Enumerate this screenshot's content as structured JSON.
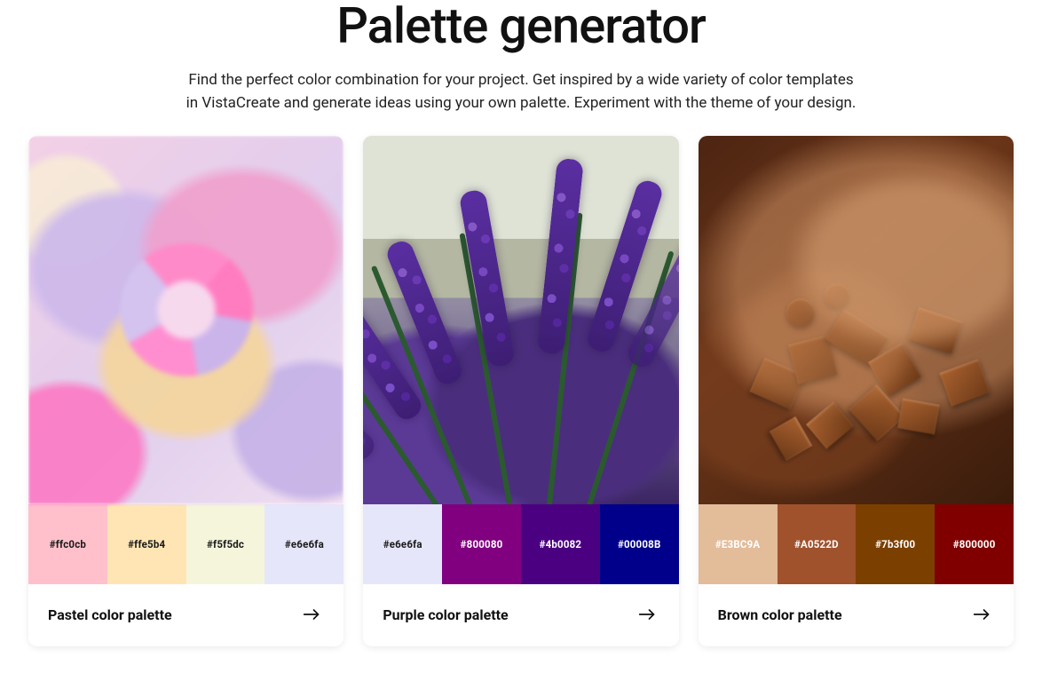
{
  "hero": {
    "title": "Palette generator",
    "description": "Find the perfect color combination for your project. Get inspired by a wide variety of color templates in VistaCreate and generate ideas using your own palette. Experiment with the theme of your design."
  },
  "palettes": [
    {
      "title": "Pastel color palette",
      "swatches": [
        {
          "hex": "#ffc0cb",
          "label": "#ffc0cb",
          "textTone": "dark"
        },
        {
          "hex": "#ffe5b4",
          "label": "#ffe5b4",
          "textTone": "dark"
        },
        {
          "hex": "#f5f5dc",
          "label": "#f5f5dc",
          "textTone": "dark"
        },
        {
          "hex": "#e6e6fa",
          "label": "#e6e6fa",
          "textTone": "dark"
        }
      ]
    },
    {
      "title": "Purple color palette",
      "swatches": [
        {
          "hex": "#e6e6fa",
          "label": "#e6e6fa",
          "textTone": "dark"
        },
        {
          "hex": "#800080",
          "label": "#800080",
          "textTone": "light"
        },
        {
          "hex": "#4b0082",
          "label": "#4b0082",
          "textTone": "light"
        },
        {
          "hex": "#00008B",
          "label": "#00008B",
          "textTone": "light"
        }
      ]
    },
    {
      "title": "Brown color palette",
      "swatches": [
        {
          "hex": "#E3BC9A",
          "label": "#E3BC9A",
          "textTone": "light"
        },
        {
          "hex": "#A0522D",
          "label": "#A0522D",
          "textTone": "light"
        },
        {
          "hex": "#7b3f00",
          "label": "#7b3f00",
          "textTone": "light"
        },
        {
          "hex": "#800000",
          "label": "#800000",
          "textTone": "light"
        }
      ]
    }
  ]
}
